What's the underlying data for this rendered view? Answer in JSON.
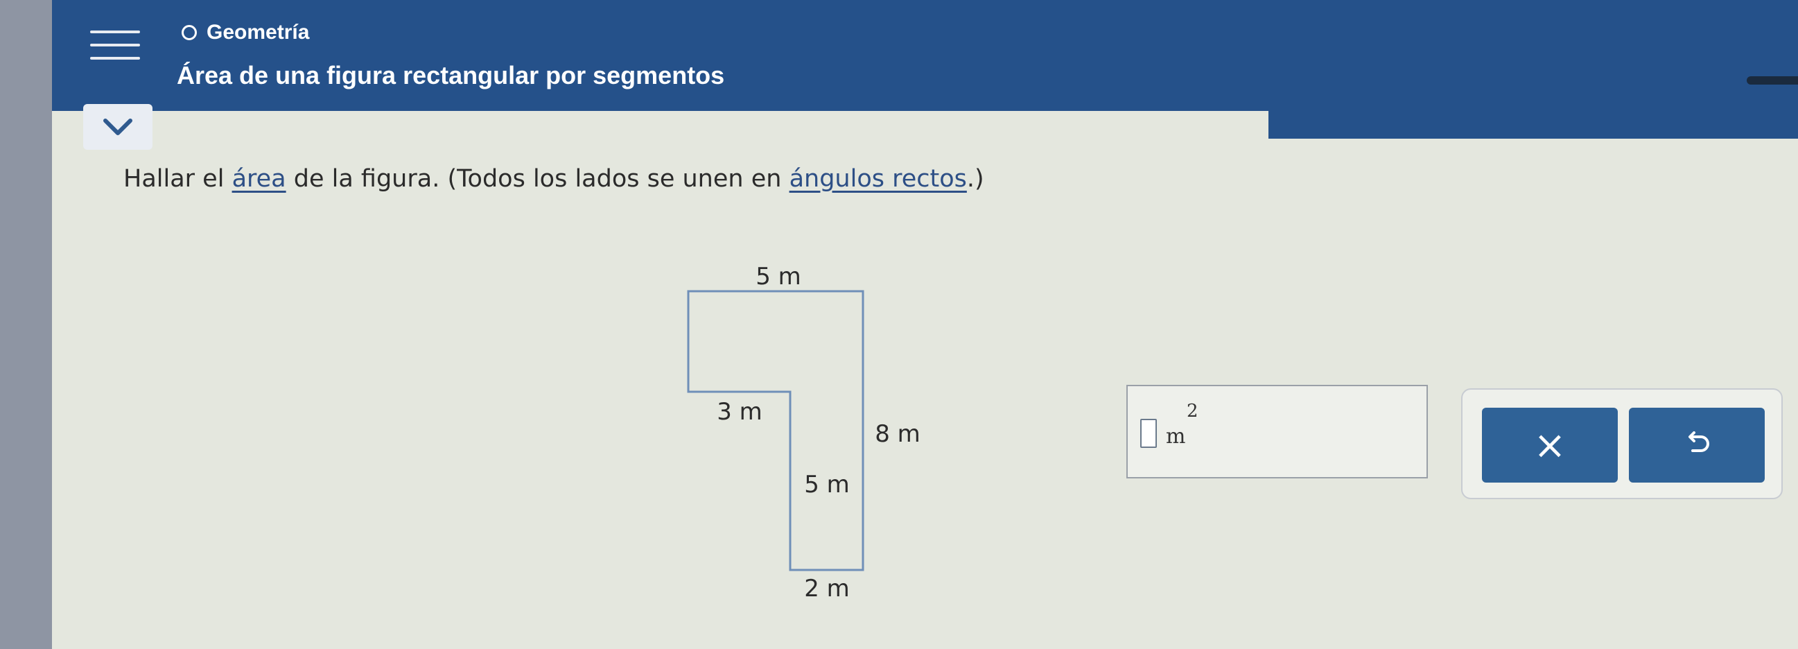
{
  "header": {
    "topic": "Geometría",
    "title": "Área de una figura rectangular por segmentos",
    "menu_icon": "hamburger-icon",
    "collapse_icon": "chevron-down-icon"
  },
  "question": {
    "text_1": "Hallar el ",
    "kw_1": "área",
    "text_2": " de la figura. (Todos los lados se unen en ",
    "kw_2": "ángulos rectos",
    "text_3": ".)"
  },
  "figure": {
    "label_top": "5 m",
    "label_left": "3 m",
    "label_right": "8 m",
    "label_inner": "5 m",
    "label_bottom": "2 m"
  },
  "answer": {
    "unit": "m",
    "exponent": "2"
  },
  "buttons": {
    "clear_symbol": "×",
    "clear_icon": "close-icon",
    "undo_icon": "undo-icon"
  },
  "colors": {
    "header": "#25518a",
    "button": "#2f6297",
    "link": "#2d4f86",
    "figure_stroke": "#6f8fb8"
  }
}
